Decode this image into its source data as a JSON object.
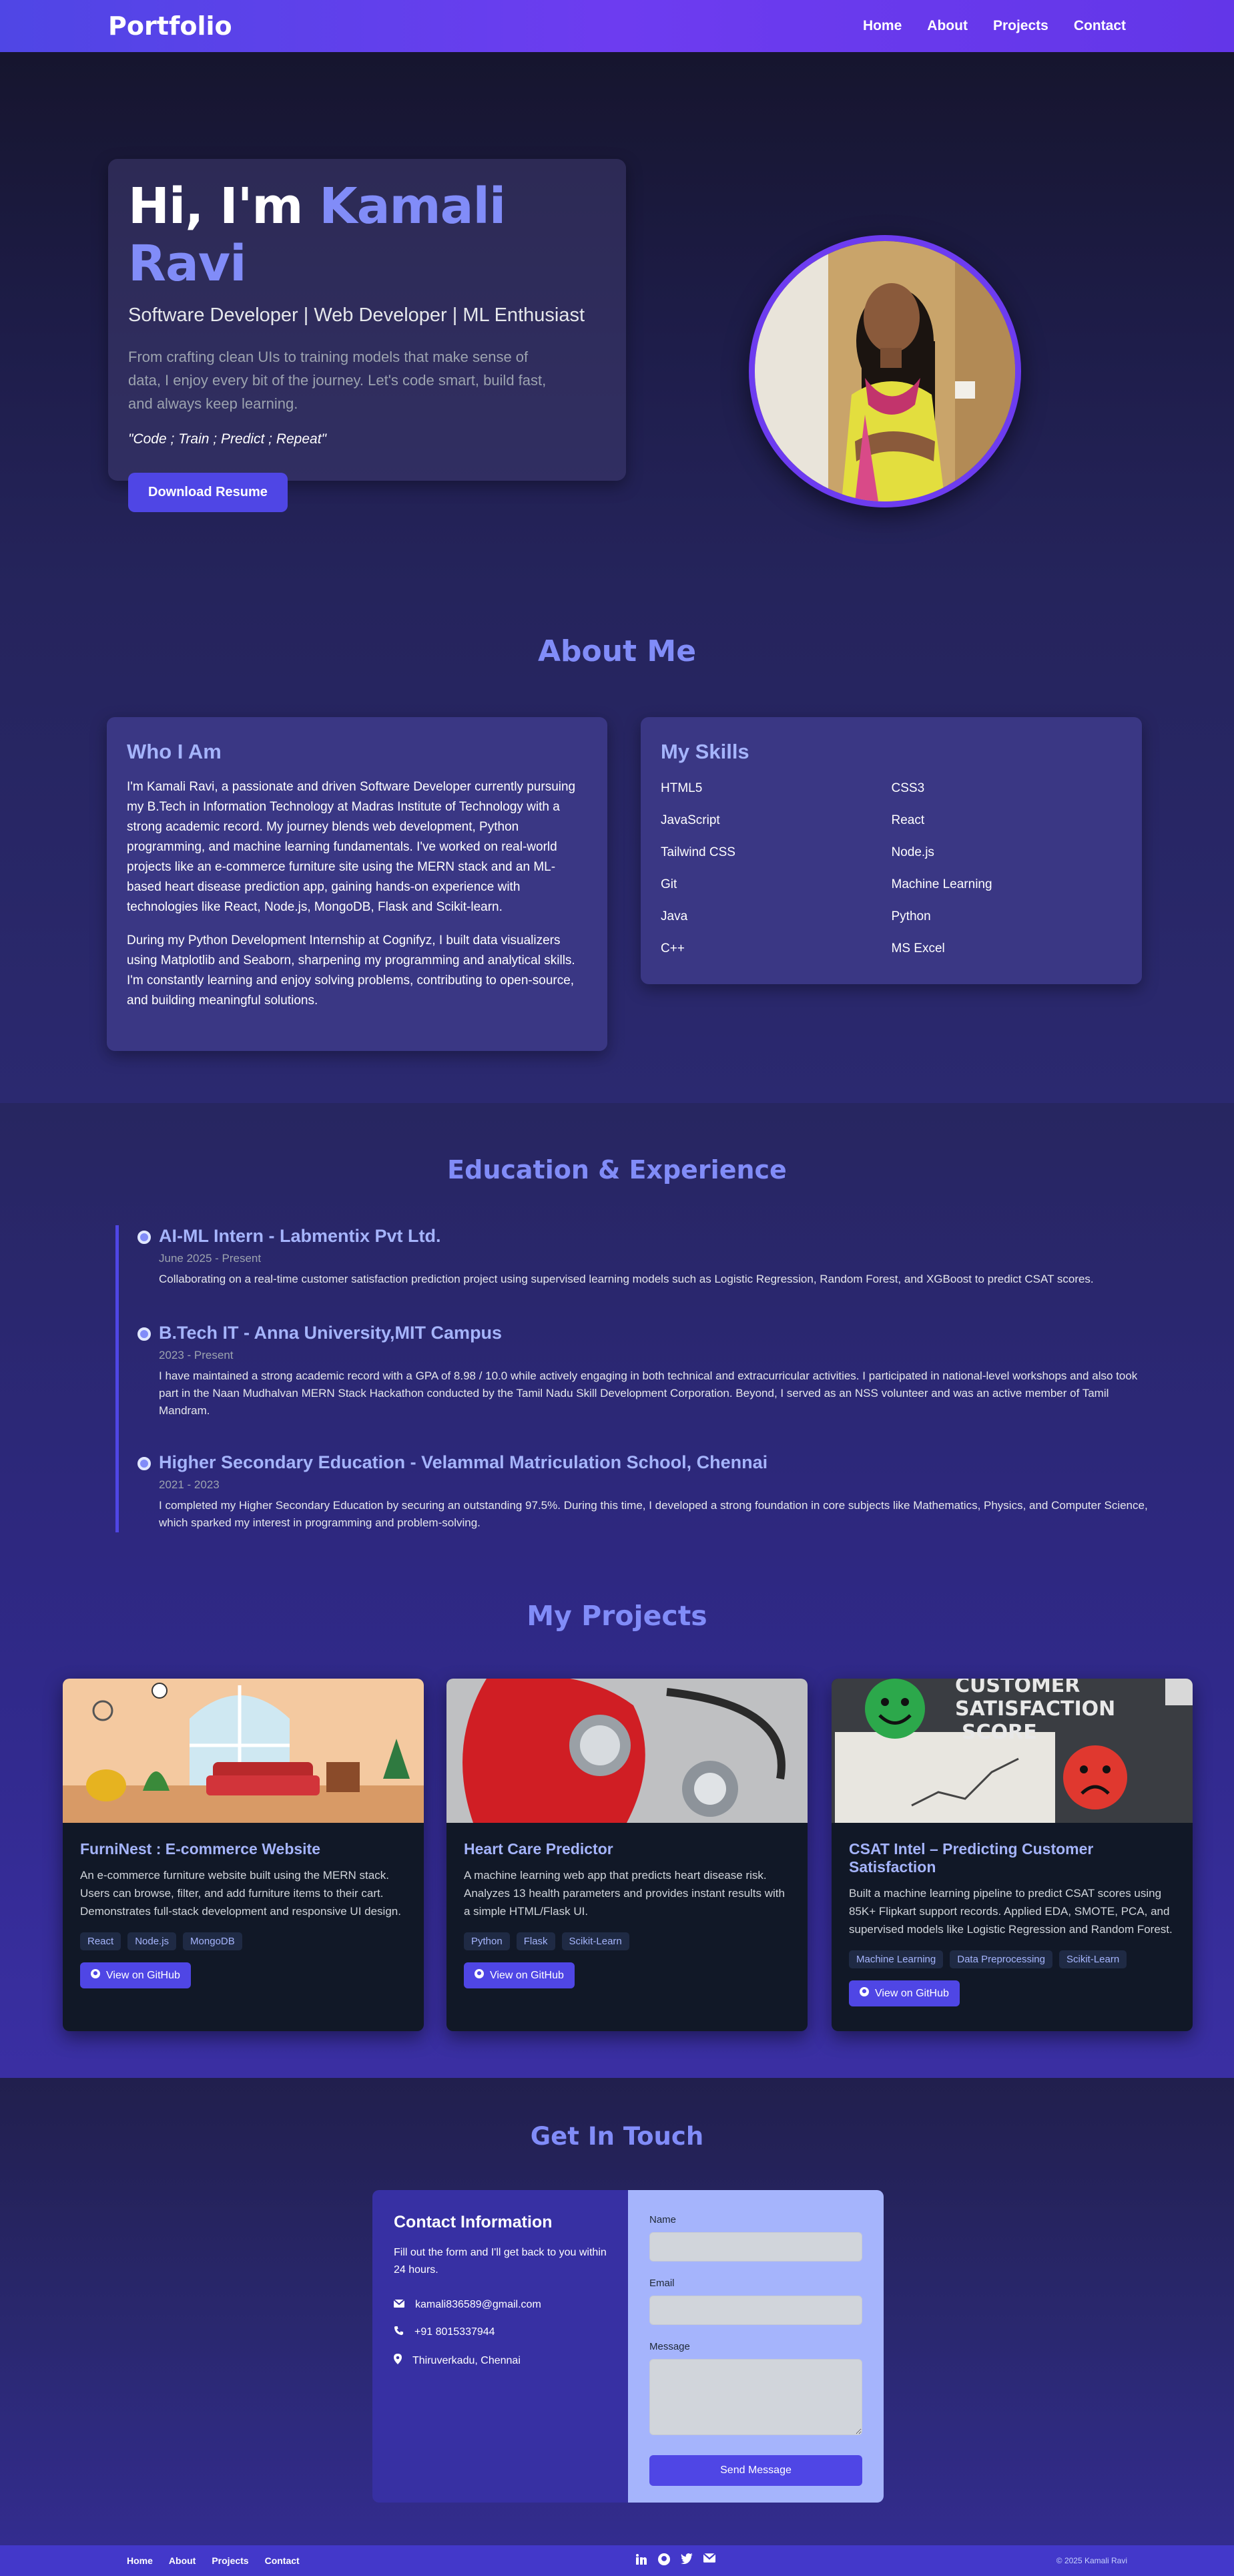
{
  "nav": {
    "brand": "Portfolio",
    "links": [
      "Home",
      "About",
      "Projects",
      "Contact"
    ]
  },
  "hero": {
    "greeting": "Hi, I'm ",
    "name": "Kamali Ravi",
    "subtitle": "Software Developer | Web Developer | ML Enthusiast",
    "description": "From crafting clean UIs to training models that make sense of data, I enjoy every bit of the journey. Let's code smart, build fast, and always keep learning.",
    "quote": "\"Code ; Train ; Predict ; Repeat\"",
    "resume_button": "Download Resume"
  },
  "about": {
    "title": "About Me",
    "who": {
      "heading": "Who I Am",
      "p1": "I'm Kamali Ravi, a passionate and driven Software Developer currently pursuing my B.Tech in Information Technology at Madras Institute of Technology with a strong academic record. My journey blends web development, Python programming, and machine learning fundamentals. I've worked on real-world projects like an e-commerce furniture site using the MERN stack and an ML-based heart disease prediction app, gaining hands-on experience with technologies like React, Node.js, MongoDB, Flask and Scikit-learn.",
      "p2": "During my Python Development Internship at Cognifyz, I built data visualizers using Matplotlib and Seaborn, sharpening my programming and analytical skills. I'm constantly learning and enjoy solving problems, contributing to open-source, and building meaningful solutions."
    },
    "skills": {
      "heading": "My Skills",
      "items": [
        "HTML5",
        "CSS3",
        "JavaScript",
        "React",
        "Tailwind CSS",
        "Node.js",
        "Git",
        "Machine Learning",
        "Java",
        "Python",
        "C++",
        "MS Excel"
      ]
    }
  },
  "education": {
    "title": "Education & Experience",
    "items": [
      {
        "title": "AI-ML Intern - Labmentix Pvt Ltd.",
        "date": "June 2025 - Present",
        "desc": "Collaborating on a real-time customer satisfaction prediction project using supervised learning models such as Logistic Regression, Random Forest, and XGBoost to predict CSAT scores."
      },
      {
        "title": "B.Tech IT - Anna University,MIT Campus",
        "date": "2023 - Present",
        "desc": "I have maintained a strong academic record with a GPA of 8.98 / 10.0 while actively engaging in both technical and extracurricular activities. I participated in national-level workshops and also took part in the Naan Mudhalvan MERN Stack Hackathon conducted by the Tamil Nadu Skill Development Corporation. Beyond, I served as an NSS volunteer and was an active member of Tamil Mandram."
      },
      {
        "title": "Higher Secondary Education - Velammal Matriculation School, Chennai",
        "date": "2021 - 2023",
        "desc": "I completed my Higher Secondary Education by securing an outstanding 97.5%. During this time, I developed a strong foundation in core subjects like Mathematics, Physics, and Computer Science, which sparked my interest in programming and problem-solving."
      }
    ]
  },
  "projects": {
    "title": "My Projects",
    "github_label": "View on GitHub",
    "items": [
      {
        "title": "FurniNest : E-commerce Website",
        "desc": "An e-commerce furniture website built using the MERN stack. Users can browse, filter, and add furniture items to their cart. Demonstrates full-stack development and responsive UI design.",
        "tags": [
          "React",
          "Node.js",
          "MongoDB"
        ]
      },
      {
        "title": "Heart Care Predictor",
        "desc": "A machine learning web app that predicts heart disease risk. Analyzes 13 health parameters and provides instant results with a simple HTML/Flask UI.",
        "tags": [
          "Python",
          "Flask",
          "Scikit-Learn"
        ]
      },
      {
        "title": "CSAT Intel – Predicting Customer Satisfaction",
        "desc": "Built a machine learning pipeline to predict CSAT scores using 85K+ Flipkart support records. Applied EDA, SMOTE, PCA, and supervised models like Logistic Regression and Random Forest.",
        "tags": [
          "Machine Learning",
          "Data Preprocessing",
          "Scikit-Learn"
        ],
        "image_text": [
          "CUSTOMER",
          "SATISFACTION",
          "SCORE"
        ]
      }
    ]
  },
  "contact": {
    "title": "Get In Touch",
    "heading": "Contact Information",
    "sub": "Fill out the form and I'll get back to you within 24 hours.",
    "email": "kamali836589@gmail.com",
    "phone": "+91 8015337944",
    "location": "Thiruverkadu, Chennai",
    "form": {
      "name_label": "Name",
      "email_label": "Email",
      "message_label": "Message",
      "send_label": "Send Message"
    }
  },
  "footer": {
    "links": [
      "Home",
      "About",
      "Projects",
      "Contact"
    ],
    "copyright": "© 2025 Kamali Ravi"
  },
  "icons": [
    "linkedin-icon",
    "github-icon",
    "twitter-icon",
    "mail-icon",
    "phone-icon",
    "location-icon"
  ],
  "colors": {
    "accent": "#4f46e5",
    "heading": "#818cf8",
    "light_accent": "#a5b4fc",
    "nav_gradient_end": "#6d3cf0",
    "footer": "#4338ca"
  }
}
